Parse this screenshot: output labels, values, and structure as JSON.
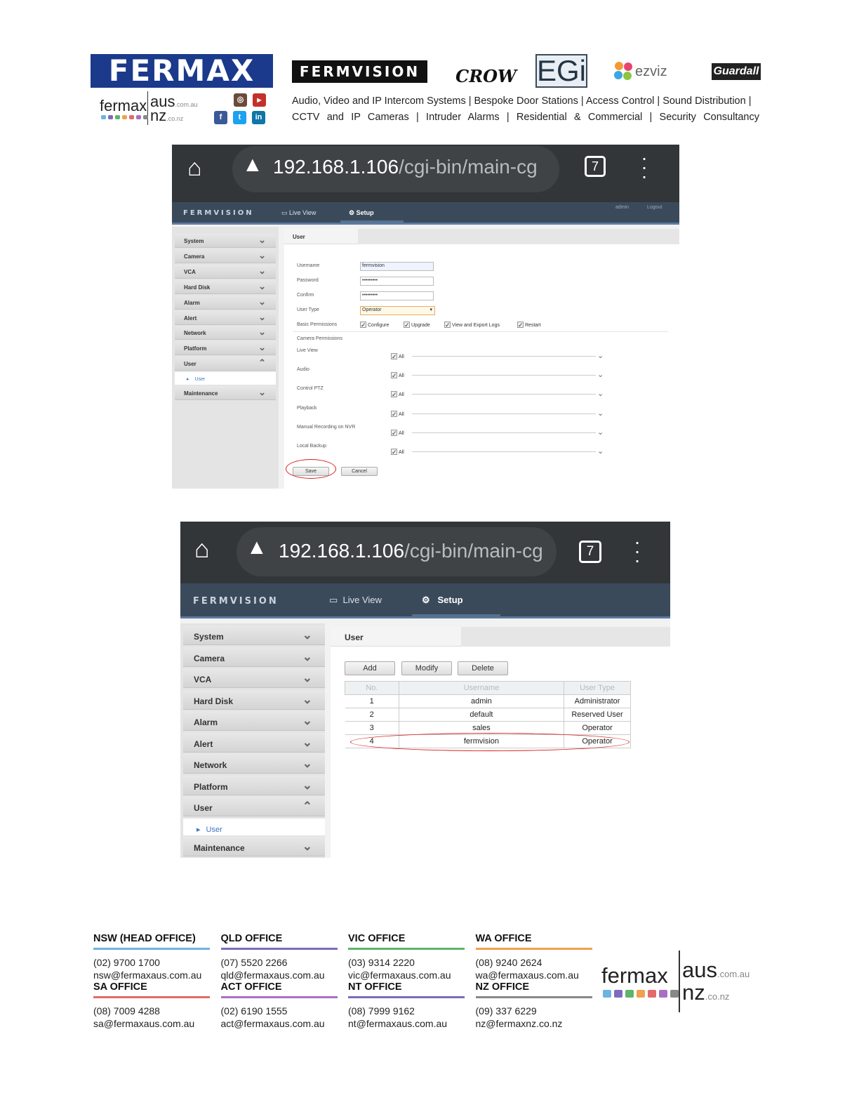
{
  "header": {
    "brand_fermax": "FERMAX",
    "fermaxaus": {
      "fermax": "fermax",
      "aus": "aus",
      "com_au": ".com.au",
      "nz": "nz",
      "co_nz": ".co.nz"
    },
    "brand_fermvision": "FERMVISION",
    "brand_crow": "CROW",
    "brand_egi": "EGi",
    "brand_ezviz": "ezviz",
    "brand_guardall": "Guardall",
    "tagline_1": "Audio, Video and IP Intercom Systems | Bespoke Door Stations | Access Control | Sound Distribution |",
    "tagline_2": "CCTV and IP Cameras | Intruder Alarms | Residential & Commercial | Security Consultancy",
    "dot_colors": [
      "#6fb3e0",
      "#7d6bbf",
      "#5fb36b",
      "#f0a050",
      "#e36a6a",
      "#a970c2",
      "#888888"
    ]
  },
  "browser": {
    "url_host": "192.168.1.106",
    "url_path": "/cgi-bin/main-cg",
    "tab_count": "7"
  },
  "app": {
    "brand": "FERMVISION",
    "nav_live": "Live View",
    "nav_setup": "Setup",
    "admin": "admin",
    "logout": "Logout",
    "sidebar": [
      "System",
      "Camera",
      "VCA",
      "Hard Disk",
      "Alarm",
      "Alert",
      "Network",
      "Platform",
      "User"
    ],
    "sidebar_sub": "User",
    "sidebar_last": "Maintenance",
    "tab_user": "User"
  },
  "form": {
    "username_label": "Username",
    "username_value": "fermvision",
    "password_label": "Password",
    "password_value": "•••••••••",
    "confirm_label": "Confirm",
    "confirm_value": "•••••••••",
    "usertype_label": "User Type",
    "usertype_value": "Operator",
    "basic_label": "Basic Permissions",
    "basic_perms": [
      "Configure",
      "Upgrade",
      "View and Export Logs",
      "Restart"
    ],
    "camera_perms_title": "Camera Permissions",
    "camera_perms": [
      "Live View",
      "Audio",
      "Control PTZ",
      "Playback",
      "Manual Recording on NVR",
      "Local Backup"
    ],
    "all_label": "All",
    "save": "Save",
    "cancel": "Cancel"
  },
  "users": {
    "add": "Add",
    "modify": "Modify",
    "delete": "Delete",
    "headers": [
      "No.",
      "Username",
      "User Type"
    ],
    "rows": [
      [
        "1",
        "admin",
        "Administrator"
      ],
      [
        "2",
        "default",
        "Reserved User"
      ],
      [
        "3",
        "sales",
        "Operator"
      ],
      [
        "4",
        "fermvision",
        "Operator"
      ]
    ]
  },
  "offices": [
    {
      "name": "NSW (HEAD OFFICE)",
      "phone": "(02) 9700 1700",
      "email": "nsw@fermaxaus.com.au",
      "color": "#6fb3e0"
    },
    {
      "name": "QLD OFFICE",
      "phone": "(07) 5520 2266",
      "email": "qld@fermaxaus.com.au",
      "color": "#7d6bbf"
    },
    {
      "name": "VIC OFFICE",
      "phone": "(03) 9314 2220",
      "email": "vic@fermaxaus.com.au",
      "color": "#5fb36b"
    },
    {
      "name": "WA OFFICE",
      "phone": "(08) 9240 2624",
      "email": "wa@fermaxaus.com.au",
      "color": "#f0a050"
    },
    {
      "name": "SA OFFICE",
      "phone": "(08) 7009 4288",
      "email": "sa@fermaxaus.com.au",
      "color": "#e36a6a"
    },
    {
      "name": "ACT OFFICE",
      "phone": "(02) 6190 1555",
      "email": "act@fermaxaus.com.au",
      "color": "#a970c2"
    },
    {
      "name": "NT OFFICE",
      "phone": "(08) 7999 9162",
      "email": "nt@fermaxaus.com.au",
      "color": "#7d6bbf"
    },
    {
      "name": "NZ OFFICE",
      "phone": "(09) 337 6229",
      "email": "nz@fermaxnz.co.nz",
      "color": "#888888"
    }
  ]
}
